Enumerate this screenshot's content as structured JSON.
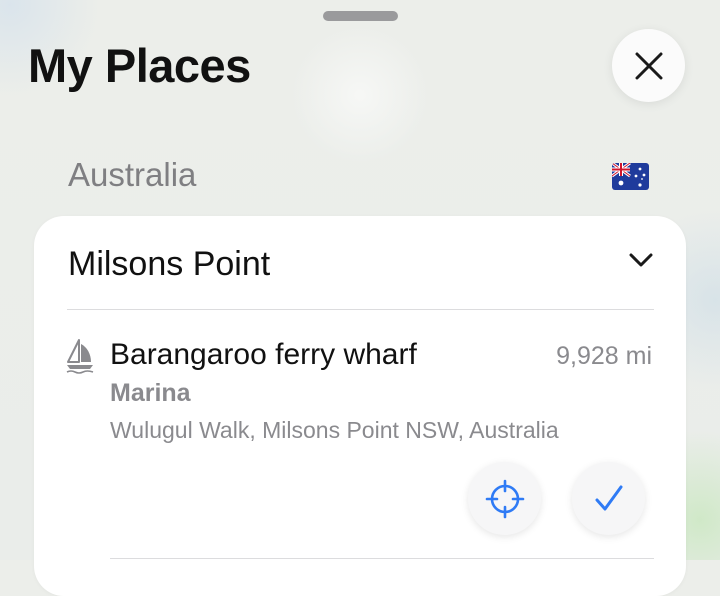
{
  "header": {
    "title": "My Places"
  },
  "close_button": {
    "icon": "close-icon"
  },
  "section": {
    "country": "Australia",
    "flag_icon": "australia-flag-icon"
  },
  "card": {
    "title": "Milsons Point",
    "expand_icon": "chevron-down-icon",
    "place": {
      "icon": "sailboat-icon",
      "name": "Barangaroo ferry wharf",
      "distance": "9,928 mi",
      "category": "Marina",
      "address": "Wulugul Walk, Milsons Point NSW, Australia"
    },
    "actions": {
      "locate_icon": "crosshair-icon",
      "confirm_icon": "checkmark-icon"
    }
  },
  "colors": {
    "accent": "#2f7bf5",
    "primary_text": "#111111",
    "secondary_text": "#8a8a8e",
    "card_background": "#ffffff"
  }
}
